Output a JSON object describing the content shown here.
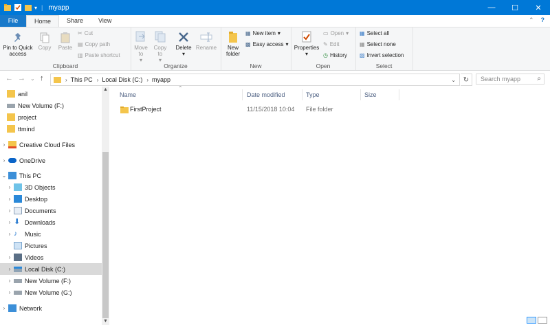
{
  "window": {
    "title": "myapp"
  },
  "tabs": [
    "File",
    "Home",
    "Share",
    "View"
  ],
  "ribbon": {
    "clipboard": {
      "label": "Clipboard",
      "pin": "Pin to Quick access",
      "copy": "Copy",
      "paste": "Paste",
      "cut": "Cut",
      "copy_path": "Copy path",
      "paste_shortcut": "Paste shortcut"
    },
    "organize": {
      "label": "Organize",
      "move_to": "Move to",
      "copy_to": "Copy to",
      "delete": "Delete",
      "rename": "Rename"
    },
    "new": {
      "label": "New",
      "new_folder": "New folder",
      "new_item": "New item",
      "easy_access": "Easy access"
    },
    "open": {
      "label": "Open",
      "properties": "Properties",
      "open": "Open",
      "edit": "Edit",
      "history": "History"
    },
    "select": {
      "label": "Select",
      "select_all": "Select all",
      "select_none": "Select none",
      "invert": "Invert selection"
    }
  },
  "address": {
    "crumbs": [
      "This PC",
      "Local Disk (C:)",
      "myapp"
    ],
    "search_placeholder": "Search myapp"
  },
  "nav": [
    {
      "label": "anil",
      "icon": "folder-icon"
    },
    {
      "label": "New Volume (F:)",
      "icon": "drive-icon"
    },
    {
      "label": "project",
      "icon": "folder-icon"
    },
    {
      "label": "ttmind",
      "icon": "folder-icon"
    },
    {
      "label": "Creative Cloud Files",
      "icon": "cc-folder-icon"
    },
    {
      "label": "OneDrive",
      "icon": "cloud-icon"
    },
    {
      "label": "This PC",
      "icon": "pc-icon"
    },
    {
      "label": "3D Objects",
      "icon": "cube-icon"
    },
    {
      "label": "Desktop",
      "icon": "desktop-icon"
    },
    {
      "label": "Documents",
      "icon": "documents-icon"
    },
    {
      "label": "Downloads",
      "icon": "download-icon"
    },
    {
      "label": "Music",
      "icon": "music-icon"
    },
    {
      "label": "Pictures",
      "icon": "pictures-icon"
    },
    {
      "label": "Videos",
      "icon": "videos-icon"
    },
    {
      "label": "Local Disk (C:)",
      "icon": "drive-icon"
    },
    {
      "label": "New Volume (F:)",
      "icon": "drive-icon"
    },
    {
      "label": "New Volume (G:)",
      "icon": "drive-icon"
    },
    {
      "label": "Network",
      "icon": "network-icon"
    }
  ],
  "columns": [
    "Name",
    "Date modified",
    "Type",
    "Size"
  ],
  "files": [
    {
      "name": "FirstProject",
      "date": "11/15/2018 10:04",
      "type": "File folder",
      "size": ""
    }
  ],
  "colors": {
    "titlebar": "#0078d7",
    "folder": "#f4c54c",
    "accent": "#1979ca"
  }
}
